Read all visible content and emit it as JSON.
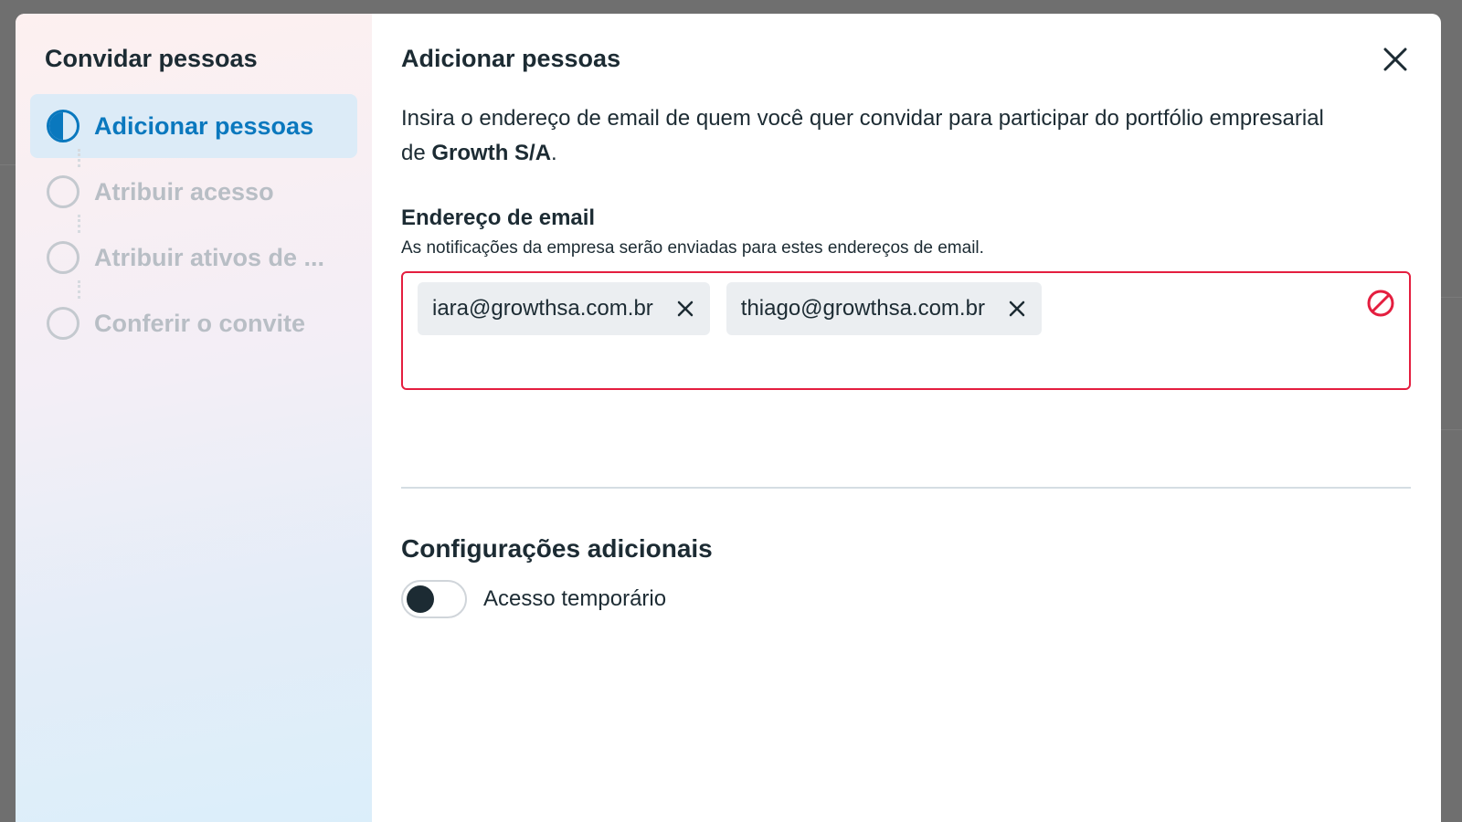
{
  "sidebar": {
    "title": "Convidar pessoas",
    "steps": [
      {
        "label": "Adicionar pessoas",
        "active": true
      },
      {
        "label": "Atribuir acesso",
        "active": false
      },
      {
        "label": "Atribuir ativos de ...",
        "active": false
      },
      {
        "label": "Conferir o convite",
        "active": false
      }
    ]
  },
  "main": {
    "title": "Adicionar pessoas",
    "description_prefix": "Insira o endereço de email de quem você quer convidar para participar do portfólio empresarial de ",
    "description_bold": "Growth S/A",
    "description_suffix": ".",
    "email_field": {
      "label": "Endereço de email",
      "help": "As notificações da empresa serão enviadas para estes endereços de email.",
      "chips": [
        "iara@growthsa.com.br",
        "thiago@growthsa.com.br"
      ],
      "error_color": "#e41e3f"
    },
    "additional": {
      "title": "Configurações adicionais",
      "toggle_label": "Acesso temporário",
      "toggle_on": false
    }
  },
  "colors": {
    "accent": "#0a78be",
    "text": "#1c2b33",
    "error": "#e41e3f"
  }
}
